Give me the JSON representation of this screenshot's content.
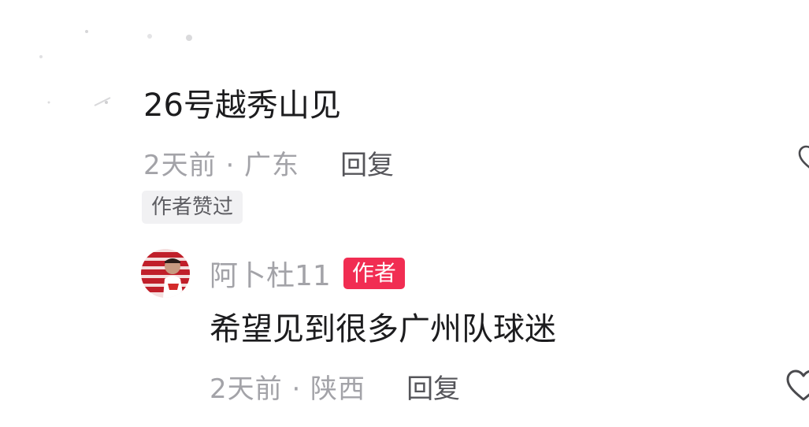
{
  "comment": {
    "text": "26号越秀山见",
    "meta": "2天前 · 广东",
    "reply_label": "回复",
    "liked_badge": "作者赞过"
  },
  "reply": {
    "username": "阿卜杜11",
    "author_tag": "作者",
    "text": "希望见到很多广州队球迷",
    "meta": "2天前 · 陕西",
    "reply_label": "回复"
  },
  "colors": {
    "author_tag_bg": "#f12d52",
    "text_primary": "#1c1c1e",
    "text_secondary": "#a3a3a8"
  },
  "icons": {
    "like": "heart-outline-icon",
    "avatar": "user-avatar"
  }
}
